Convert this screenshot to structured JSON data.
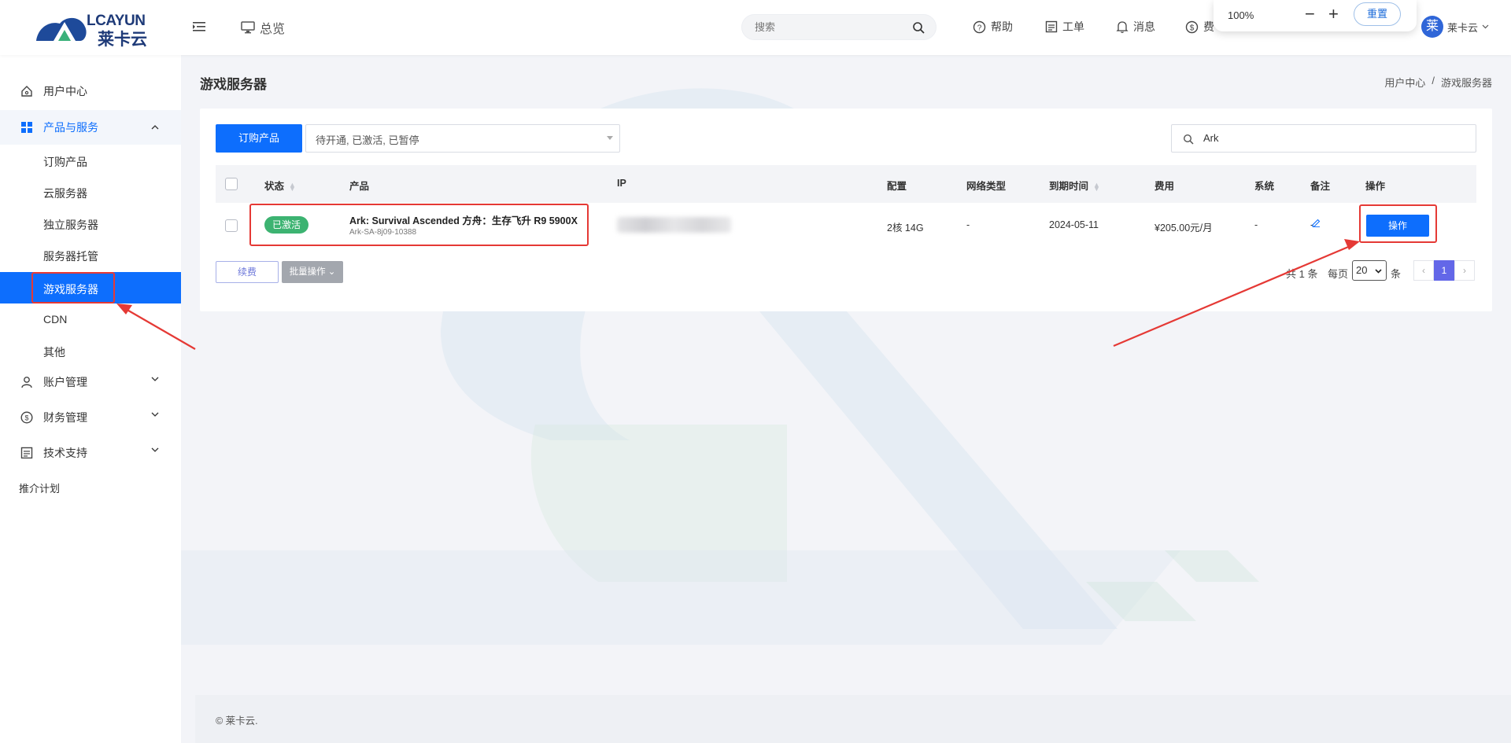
{
  "header": {
    "logo_text": "LCAYUN",
    "logo_cn": "莱卡云",
    "overview_label": "总览",
    "search_placeholder": "搜索",
    "help_label": "帮助",
    "ticket_label": "工单",
    "message_label": "消息",
    "billing_label": "费",
    "user_name": "莱卡云",
    "avatar_char": "莱"
  },
  "zoom": {
    "level": "100%",
    "minus": "−",
    "plus": "+",
    "reset_label": "重置"
  },
  "sidebar": {
    "items": [
      {
        "label": "用户中心"
      },
      {
        "label": "产品与服务"
      },
      {
        "label": "订购产品"
      },
      {
        "label": "云服务器"
      },
      {
        "label": "独立服务器"
      },
      {
        "label": "服务器托管"
      },
      {
        "label": "游戏服务器"
      },
      {
        "label": "CDN"
      },
      {
        "label": "其他"
      },
      {
        "label": "账户管理"
      },
      {
        "label": "财务管理"
      },
      {
        "label": "技术支持"
      },
      {
        "label": "推介计划"
      }
    ]
  },
  "main": {
    "page_title": "游戏服务器",
    "breadcrumb": [
      "用户中心",
      "/",
      "游戏服务器"
    ],
    "order_button": "订购产品",
    "status_filter": "待开通, 已激活, 已暂停",
    "table_search_value": "Ark",
    "columns": [
      "状态",
      "产品",
      "IP",
      "配置",
      "网络类型",
      "到期时间",
      "费用",
      "系统",
      "备注",
      "操作"
    ],
    "rows": [
      {
        "status": "已激活",
        "product_name": "Ark: Survival Ascended 方舟：生存飞升 R9 5900X",
        "product_id": "Ark-SA-8j09-10388",
        "config": "2核 14G",
        "network": "-",
        "expire": "2024-05-11",
        "fee": "¥205.00元/月",
        "system": "-",
        "note": "-",
        "action": "操作"
      }
    ],
    "renew_button": "续费",
    "batch_button": "批量操作 ⌄",
    "pager": {
      "total": "共 1 条",
      "per_page_label": "每页",
      "per_page": "20",
      "unit": "条",
      "prev": "‹",
      "current": "1",
      "next": "›"
    }
  },
  "footer": {
    "copyright": "© 莱卡云."
  },
  "colors": {
    "primary": "#0d6efd",
    "active_badge": "#3cb371",
    "annotation": "#e53935"
  }
}
